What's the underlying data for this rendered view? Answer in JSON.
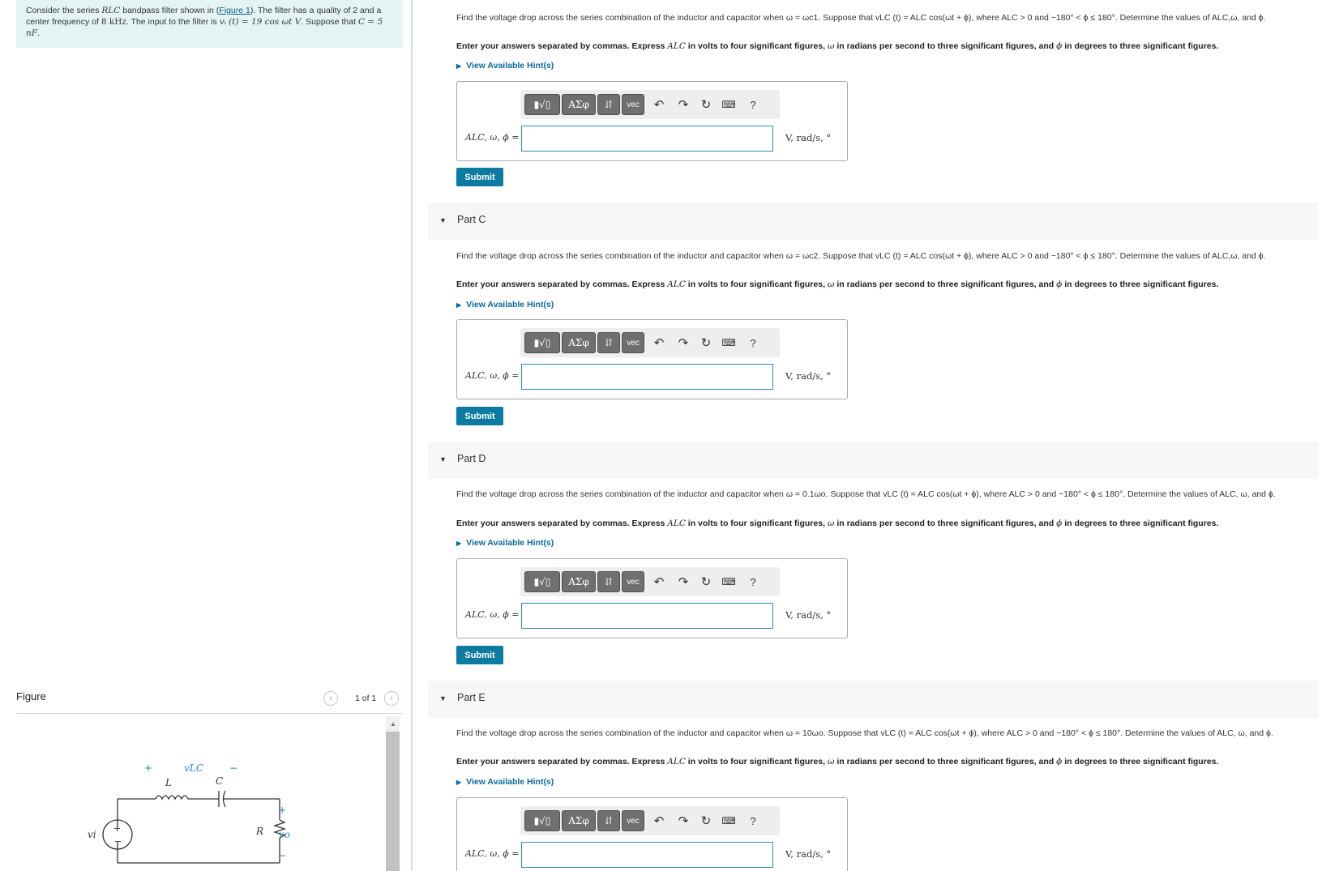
{
  "problem": {
    "text_1": "Consider the series ",
    "rlc": "RLC",
    "text_2": " bandpass filter shown in (",
    "figure_link": "Figure 1",
    "text_3": "). The filter has a quality of 2 and a center frequency of ",
    "freq": "8 kHz",
    "text_4": ". The input to the filter is ",
    "input_expr": "vᵢ (t) = 19 cos ωt V",
    "text_5": ". Suppose that ",
    "cap": "C = 5 nF",
    "text_6": "."
  },
  "figure": {
    "title": "Figure",
    "pager": "1 of 1",
    "prev_icon": "chevron-left-icon",
    "next_icon": "chevron-right-icon",
    "labels": {
      "vlc": "vLC",
      "plus": "+",
      "minus": "−",
      "L": "L",
      "C": "C",
      "R": "R",
      "vi": "vi",
      "vo": "vo"
    }
  },
  "common": {
    "hint": "View Available Hint(s)",
    "answer_label": "ALC, ω, ϕ =",
    "units": "V, rad/s, °",
    "submit": "Submit",
    "instruction_1": "Enter your answers separated by commas. Express ",
    "instruction_alc": "ALC",
    "instruction_2": " in volts to four significant figures, ",
    "instruction_w": "ω",
    "instruction_3": " in radians per second to three significant figures, and ",
    "instruction_phi": "ϕ",
    "instruction_4": " in degrees to three significant figures.",
    "toolbar": {
      "templates": "▮√▯",
      "greek": "ΑΣφ",
      "arrows": "⇵",
      "vec": "vec",
      "undo_icon": "undo-icon",
      "redo_icon": "redo-icon",
      "reset_icon": "reset-icon",
      "keyboard_icon": "keyboard-icon",
      "help": "?"
    }
  },
  "parts": [
    {
      "title": "",
      "question": "Find the voltage drop across the series combination of the inductor and capacitor when ω = ωc1. Suppose that vLC (t) = ALC cos(ωt + ϕ), where ALC > 0 and −180° < ϕ ≤ 180°. Determine the values of ALC,ω, and ϕ."
    },
    {
      "title": "Part C",
      "question": "Find the voltage drop across the series combination of the inductor and capacitor when ω = ωc2. Suppose that vLC (t) = ALC cos(ωt + ϕ), where ALC > 0 and −180° < ϕ ≤ 180°. Determine the values of ALC,ω, and ϕ."
    },
    {
      "title": "Part D",
      "question": "Find the voltage drop across the series combination of the inductor and capacitor when ω = 0.1ωo. Suppose that vLC (t) = ALC cos(ωt + ϕ), where ALC > 0 and −180° < ϕ ≤ 180°. Determine the values of ALC, ω, and ϕ."
    },
    {
      "title": "Part E",
      "question": "Find the voltage drop across the series combination of the inductor and capacitor when ω = 10ωo. Suppose that vLC (t) = ALC cos(ωt + ϕ), where ALC > 0 and −180° < ϕ ≤ 180°. Determine the values of ALC, ω, and ϕ."
    }
  ]
}
